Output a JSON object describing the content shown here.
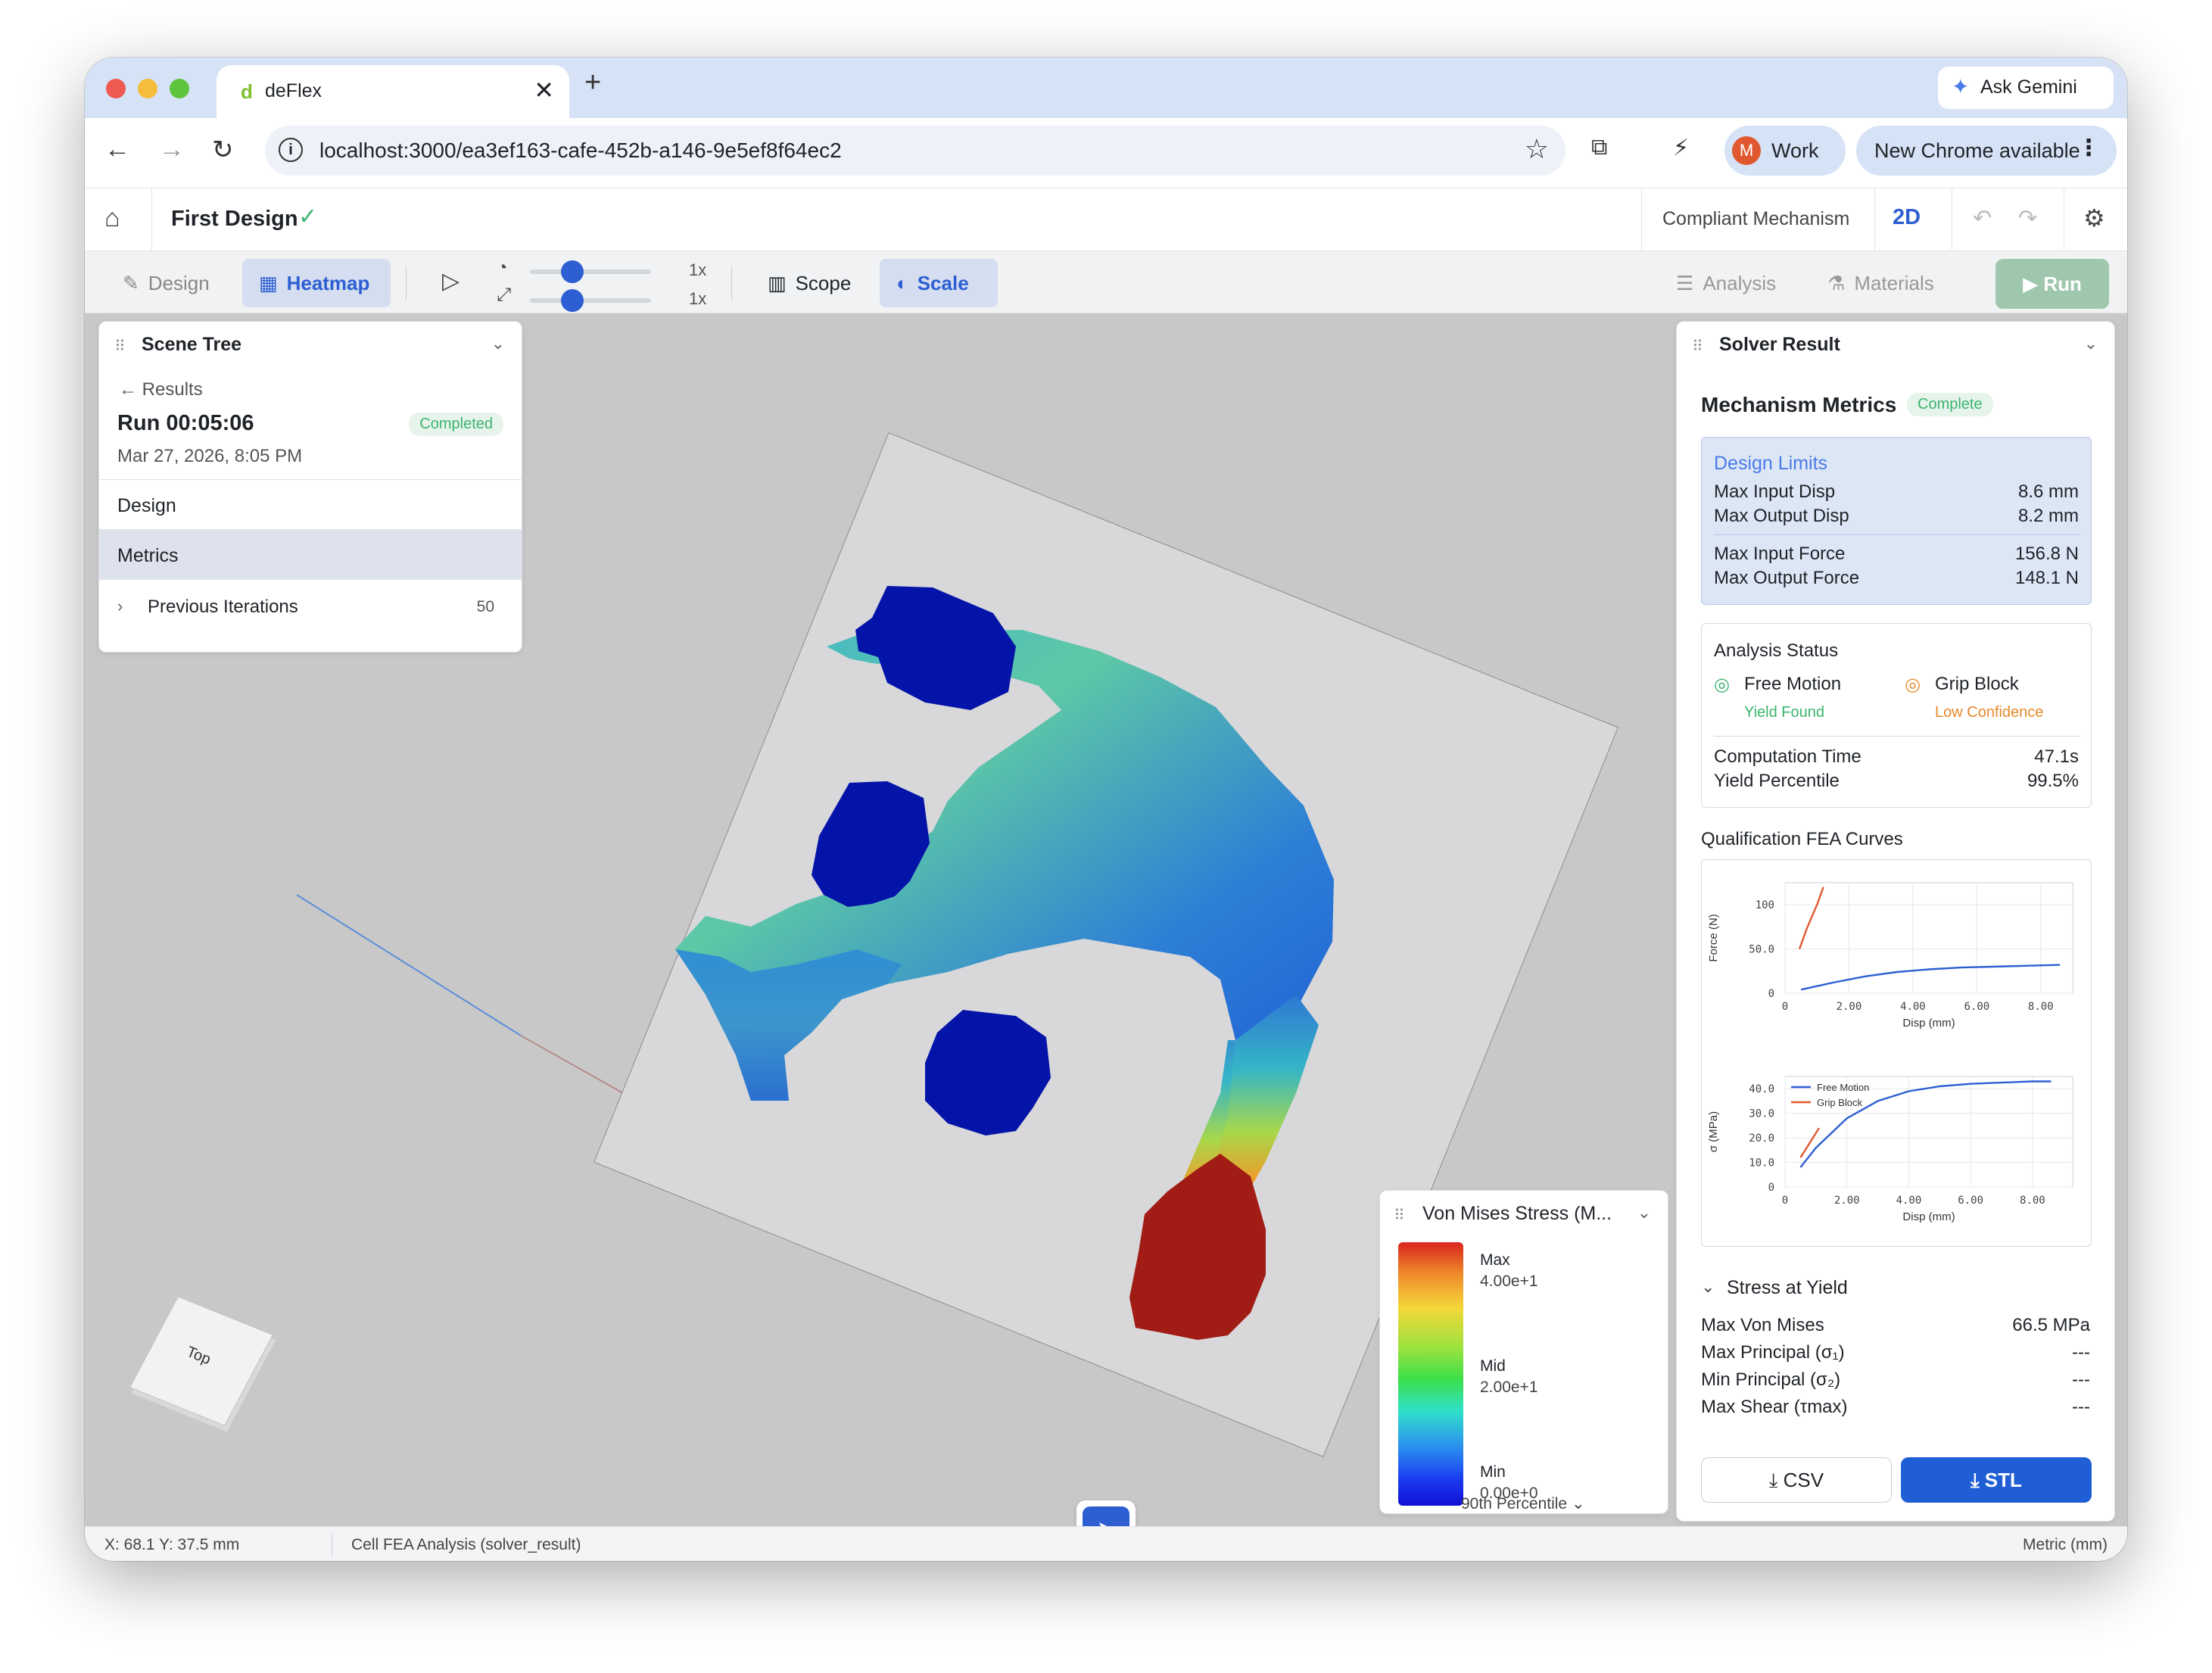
{
  "browser": {
    "tab_title": "deFlex",
    "tab_favicon": "d",
    "url": "localhost:3000/ea3ef163-cafe-452b-a146-9e5ef8f64ec2",
    "ask_gemini": "Ask Gemini",
    "profile_initial": "M",
    "profile_label": "Work",
    "update_label": "New Chrome available"
  },
  "app": {
    "design_name": "First Design",
    "mode_label": "Compliant Mechanism",
    "view_mode": "2D"
  },
  "toolbar": {
    "design": "Design",
    "heatmap": "Heatmap",
    "speed_label": "1x",
    "scale_label": "1x",
    "speed_level": 0.35,
    "scale_level": 0.35,
    "scope": "Scope",
    "scale": "Scale",
    "analysis": "Analysis",
    "materials": "Materials",
    "run": "Run"
  },
  "scene_tree": {
    "title": "Scene Tree",
    "back": "Results",
    "run_title": "Run 00:05:06",
    "status": "Completed",
    "date": "Mar 27, 2026, 8:05 PM",
    "items": [
      "Design",
      "Metrics"
    ],
    "previous_label": "Previous Iterations",
    "previous_count": "50"
  },
  "legend": {
    "title": "Von Mises Stress (M...",
    "max_label": "Max",
    "max_value": "4.00e+1",
    "mid_label": "Mid",
    "mid_value": "2.00e+1",
    "min_label": "Min",
    "min_value": "0.00e+0",
    "percentile": "90th Percentile"
  },
  "viewcube": {
    "face": "Top"
  },
  "solver": {
    "title": "Solver Result",
    "section_title": "Mechanism Metrics",
    "status": "Complete",
    "limits_title": "Design Limits",
    "limits": [
      {
        "label": "Max Input Disp",
        "value": "8.6 mm"
      },
      {
        "label": "Max Output Disp",
        "value": "8.2 mm"
      },
      {
        "label": "Max Input Force",
        "value": "156.8 N"
      },
      {
        "label": "Max Output Force",
        "value": "148.1 N"
      }
    ],
    "analysis_title": "Analysis Status",
    "free_motion": "Free Motion",
    "free_motion_status": "Yield Found",
    "grip_block": "Grip Block",
    "grip_block_status": "Low Confidence",
    "computation_label": "Computation Time",
    "computation_value": "47.1s",
    "yield_label": "Yield Percentile",
    "yield_value": "99.5%",
    "curves_title": "Qualification FEA Curves",
    "stress_title": "Stress at Yield",
    "stress": [
      {
        "label": "Max Von Mises",
        "value": "66.5 MPa"
      },
      {
        "label": "Max Principal (σ₁)",
        "value": "---"
      },
      {
        "label": "Min Principal (σ₂)",
        "value": "---"
      },
      {
        "label": "Max Shear (τmax)",
        "value": "---"
      }
    ],
    "csv": "CSV",
    "stl": "STL"
  },
  "status_bar": {
    "coords": "X: 68.1 Y: 37.5 mm",
    "mode": "Cell FEA Analysis (solver_result)",
    "units": "Metric (mm)"
  },
  "colors": {
    "accent": "#2d5fd3",
    "success": "#3cb46e",
    "warning": "#e88a2a"
  },
  "chart_data": [
    {
      "type": "line",
      "xlabel": "Disp (mm)",
      "ylabel": "Force (N)",
      "xlim": [
        0,
        9
      ],
      "ylim": [
        0,
        125
      ],
      "x_ticks": [
        "0",
        "2.00",
        "4.00",
        "6.00",
        "8.00"
      ],
      "y_ticks": [
        "0",
        "50.0",
        "100"
      ],
      "series": [
        {
          "name": "",
          "color": "#2d5fd3",
          "x": [
            0.5,
            1.5,
            2.5,
            3.5,
            4.5,
            5.5,
            6.5,
            7.5,
            8.6
          ],
          "y": [
            4,
            12,
            19,
            24,
            27,
            29,
            30,
            31,
            32
          ]
        },
        {
          "name": "",
          "color": "#e0582f",
          "x": [
            0.45,
            0.7,
            1.0,
            1.2
          ],
          "y": [
            50,
            75,
            100,
            120
          ]
        }
      ]
    },
    {
      "type": "line",
      "xlabel": "Disp (mm)",
      "ylabel": "σ (MPa)",
      "xlim": [
        0,
        9.3
      ],
      "ylim": [
        0,
        45
      ],
      "x_ticks": [
        "0",
        "2.00",
        "4.00",
        "6.00",
        "8.00"
      ],
      "y_ticks": [
        "0",
        "10.0",
        "20.0",
        "30.0",
        "40.0"
      ],
      "series": [
        {
          "name": "Free Motion",
          "color": "#2d5fd3",
          "x": [
            0.5,
            1.0,
            2.0,
            3.0,
            4.0,
            5.0,
            6.0,
            7.0,
            8.0,
            8.6
          ],
          "y": [
            8,
            16,
            28,
            35,
            39,
            41,
            42,
            42.5,
            43,
            43
          ]
        },
        {
          "name": "Grip Block",
          "color": "#e0582f",
          "x": [
            0.5,
            0.8,
            1.1
          ],
          "y": [
            12,
            18,
            24
          ]
        }
      ]
    }
  ]
}
